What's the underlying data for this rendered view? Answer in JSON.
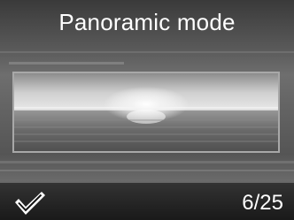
{
  "title": "Panoramic mode",
  "counter": "6/25",
  "icons": {
    "select": "checkmark-icon"
  }
}
